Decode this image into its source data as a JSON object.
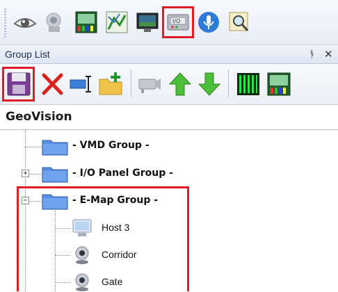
{
  "toolbar": {
    "icons": [
      "eye-icon",
      "camera-3d-icon",
      "vmd-panel-icon",
      "map-icon",
      "monitor-icon",
      "io-panel-icon",
      "microphone-icon",
      "search-icon"
    ],
    "highlighted": "io-panel-icon"
  },
  "panel": {
    "title": "Group List",
    "pin_glyph": "ᚬ",
    "close_glyph": "✕"
  },
  "group_toolbar": {
    "icons": [
      "save-icon",
      "delete-icon",
      "rename-icon",
      "new-folder-icon",
      "camera-icon",
      "move-up-icon",
      "move-down-icon",
      "matrix-icon",
      "vmd-panel-icon"
    ],
    "highlighted": "save-icon"
  },
  "tree": {
    "root": "GeoVision",
    "groups": [
      {
        "label": "- VMD Group -",
        "expander": ""
      },
      {
        "label": "- I/O Panel Group -",
        "expander": "+"
      },
      {
        "label": "- E-Map Group -",
        "expander": "−",
        "children": [
          "Host 3",
          "Corridor",
          "Gate"
        ]
      }
    ]
  },
  "colors": {
    "highlight": "#e01b24",
    "folder": "#5b8fe0"
  }
}
